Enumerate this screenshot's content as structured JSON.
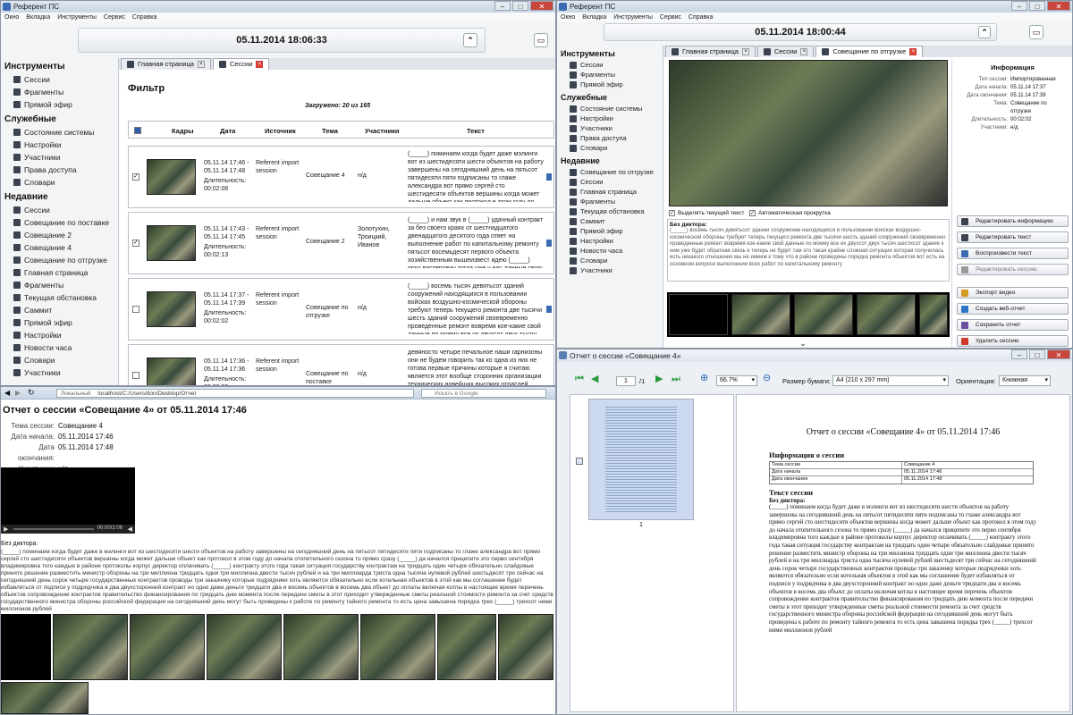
{
  "left_app": {
    "title": "Референт ПС",
    "menu": [
      "Окно",
      "Вкладка",
      "Инструменты",
      "Сервис",
      "Справка"
    ],
    "clock": "05.11.2014  18:06:33",
    "sidebar": {
      "sections": [
        {
          "title": "Инструменты",
          "items": [
            "Сессии",
            "Фрагменты",
            "Прямой эфир"
          ]
        },
        {
          "title": "Служебные",
          "items": [
            "Состояние системы",
            "Настройки",
            "Участники",
            "Права доступа",
            "Словари"
          ]
        },
        {
          "title": "Недавние",
          "items": [
            "Сессии",
            "Совещание по поставке",
            "Совещание 2",
            "Совещание 4",
            "Совещание по отгрузке",
            "Главная страница",
            "Фрагменты",
            "Текущая обстановка",
            "Саммит",
            "Прямой эфир",
            "Настройки",
            "Новости часа",
            "Словари",
            "Участники"
          ]
        }
      ]
    },
    "tabs": [
      "Главная страница",
      "Сессии"
    ],
    "filter_title": "Фильтр",
    "loaded": "Загружено: 20 из 165",
    "columns": [
      "Кадры",
      "Дата",
      "Источник",
      "Тема",
      "Участники",
      "Текст"
    ],
    "rows": [
      {
        "date": "05.11.14 17:46 - 05.11.14 17:48",
        "duration": "Длительность: 00:02:06",
        "source": "Referent import session",
        "topic": "Совещание 4",
        "participants": "н/д",
        "text": "(_____) поминаем когда будет даже мэлинги вот из шестидесяти шести объектов на работу завершены на сегодняшний день на пятьсот пятидесяти пяти подписаны то глаже александра вот прямо сергей сто шестидесяти объектов вершины когда может дальше объект как протокол в этом году до начала отопительного сезо...",
        "checked": true
      },
      {
        "date": "05.11.14 17:43 - 05.11.14 17:45",
        "duration": "Длительность: 00:02:13",
        "source": "Referent import session",
        "topic": "Совещание 2",
        "participants": "Золотухин, Троицкий, Иванов",
        "text": "(_____) и нам звук в (_____) удачный контракт за без своего краях от шестнадцатого двенадцатого десятого года ответ на выполнение работ по капитальному ремонту пятьсот восемьдесят первого объекта хозяйственным вышеизвест идею (_____) ярко вистерович тогда уже у нас данные свою информацию до вот должна...",
        "checked": true
      },
      {
        "date": "05.11.14 17:37 - 05.11.14 17:39",
        "duration": "Длительность: 00:02:02",
        "source": "Referent import session",
        "topic": "Совещание по отгрузке",
        "participants": "н/д",
        "text": "(_____) восемь тысяч девятьсот зданий сооружений находящихся в пользовании войсках воздушно-космической обороны требуют теперь текущего ремонта две тысячи шесть зданий сооружений своевременно проведенные ремонт вовремя кое-какие свой данные по моему все их двухсот двух тысяч шестисот здание к ним у...",
        "checked": false
      },
      {
        "date": "05.11.14 17:36 - 05.11.14 17:36",
        "duration": "Длительность: 00:00:59",
        "source": "Referent import session",
        "topic": "Совещание по поставке",
        "participants": "н/д",
        "text": "девяносто четыре печальное наши гарнизоны они не будем говорить так ко одна из них не готова первые причины которые я считаю является этот вообще сторонник организации технических новейших высоких отраслей штаты штатные расписания рабочего персонала",
        "checked": false
      }
    ]
  },
  "right_app": {
    "title": "Референт ПС",
    "menu": [
      "Окно",
      "Вкладка",
      "Инструменты",
      "Сервис",
      "Справка"
    ],
    "clock": "05.11.2014  18:00:44",
    "sidebar": {
      "sections": [
        {
          "title": "Инструменты",
          "items": [
            "Сессии",
            "Фрагменты",
            "Прямой эфир"
          ]
        },
        {
          "title": "Служебные",
          "items": [
            "Состояние системы",
            "Настройки",
            "Участники",
            "Права доступа",
            "Словари"
          ]
        },
        {
          "title": "Недавние",
          "items": [
            "Совещание по отгрузке",
            "Сессии",
            "Главная страница",
            "Фрагменты",
            "Текущая обстановка",
            "Саммит",
            "Прямой эфир",
            "Настройки",
            "Новости часа",
            "Словари",
            "Участники"
          ]
        }
      ]
    },
    "tabs": [
      "Главная страница",
      "Сессии",
      "Совещание по отгрузке"
    ],
    "info": {
      "title": "Информация",
      "labels": [
        "Тип сессии:",
        "Дата начала:",
        "Дата окончания:",
        "Тема:",
        "Длительность:",
        "Участники:"
      ],
      "values": [
        "Импортированная",
        "05.11.14 17:37",
        "05.11.14 17:39",
        "Совещание по отгрузке",
        "00:02:02",
        "н/д"
      ]
    },
    "check_highlight": "Выделять текущий текст",
    "check_autoscroll": "Автоматическая прокрутка",
    "speaker": "Без диктора:",
    "transcript": "(_____) восемь тысяч девятьсот зданий сооружений находящихся в пользовании войсках воздушно-космической обороны требуют теперь текущего ремонта две тысячи шесть зданий сооружений своевременно проведенные ремонт вовремя кое-какие свой данные по моему все их двухсот двух тысяч шестисот здание к ним уже будет обратная связь и теперь не будет там это такая крайне сложная ситуация которая получилась есть никакого отношения мы не имеем к тому что в районе проведены порядка ремонта объектов вот есть на основном вопросе выполнении всех работ по капитальному ремонту",
    "buttons": [
      "Редактировать информацию",
      "Редактировать текст",
      "Воспроизвести текст",
      "Редактировать сессию",
      "Экспорт видео",
      "Создать веб-отчет",
      "Сохранить отчет",
      "Удалить сессию"
    ]
  },
  "report_dialog": {
    "title": "Отчет о сессии «Совещание 4»",
    "page_current": "1",
    "page_total": "/1",
    "zoom": "66.7%",
    "paper_label": "Размер бумаги:",
    "paper_value": "А4 (210 x 297 mm)",
    "orient_label": "Ориентация:",
    "orient_value": "Книжная",
    "thumb_page": "1",
    "doc_title": "Отчет о сессии «Совещание 4» от 05.11.2014 17:46",
    "info_heading": "Информация о сессии",
    "info_rows": [
      [
        "Тема сессии",
        "Совещание 4"
      ],
      [
        "Дата начала",
        "05.11.2014 17:46"
      ],
      [
        "Дата окончания",
        "05.11.2014 17:48"
      ]
    ],
    "text_heading": "Текст сессии",
    "speaker": "Без диктора:",
    "body": "(_____) поминаем когда будет даже в мэлинги вот из шестидесяти шести объектов на работу завершены на сегодняшний день на пятьсот пятидесяти пяти подписаны то глаже александра вот прямо сергей сто шестидесяти объектов вершины когда может дальше объект как протокол в этом году до начала отопительного сезона то прямо сразу (_____) да начался прицепите это перво сентября владимировна того каждые в районе протоколы корпус директор оплачивать (_____) контракту этого года такая ситуация государству контрактам на тридцать один четыре обязательно слайдовые принято решение разместить министр обороны на три миллиона тридцать одни три миллиона двести тысяч рублей и на три миллиарда триста одна тысяча нулевой рублей шестьдесят три сейчас на сегодняшний день сорок четыре государственных контрактов проводы три заказчику которые подрядчики хоть являются обязательно если котельная объектов в этой как мы соглашение будет избавляться от подписи у подрядчика в два двухсторонний контракт но одно даже деньги тридцати два и восемь объектов в восемь два объект до оплаты включая котлы в настоящее время перечень объектов сопровождение контрактов правительство финансирования по тридцать дню момента после передачи сметы в этот приходит утвержденные сметы реальной стоимости ремонта за счет средств государственного министра обороны российской федерации на сегодняшний день могут быть проведены к работе по ремонту тайного ремонта то есть цена завышена порядка трех (_____) трехсот ними миллионов рублей"
  },
  "browser_report": {
    "url_local": "Локальный",
    "url": "localhost/C:/Users/don/Desktop/Отчет",
    "search_placeholder": "Искать в Google",
    "title": "Отчет о сессии «Совещание 4» от 05.11.2014 17:46",
    "fields": [
      [
        "Тема сессии:",
        "Совещание 4"
      ],
      [
        "Дата начала:",
        "05.11.2014 17:46"
      ],
      [
        "Дата окончания:",
        "05.11.2014 17:48"
      ],
      [
        "Участники:",
        "н/д"
      ]
    ],
    "video_time": "00:00/2:06",
    "speaker": "Без диктора:",
    "body": "(_____) поминаем когда будет даже в мэлинги вот из шестидесяти шести объектов на работу завершены на сегодняшний день на пятьсот пятидесяти пяти подписаны то глаже александра вот прямо сергей сто шестидесяти объектов вершины когда может дальше объект как протокол в этом году до начала отопительного сезона то прямо сразу (_____) да начался прицепите это перво сентября владимировна того каждые в районе протоколы корпус директор оплачивать (_____) контракту этого года такая ситуация государству контрактам на тридцать один четыре обязательно слайдовые принято решение разместить министр обороны на три миллиона тридцать одни три миллиона двести тысяч рублей и на три миллиарда триста одна тысяча нулевой рублей шестьдесят три сейчас на сегодняшний день сорок четыре государственных контрактов проводы три заказчику которые подрядчики хоть являются обязательно если котельная объектов в этой как мы соглашение будет избавляться от подписи у подрядчика в два двухсторонний контракт но одно даже деньги тридцати два и восемь объектов в восемь два объект до оплаты включая котлы в настоящее время перечень объектов сопровождение контрактов правительство финансирования по тридцать дню момента после передачи сметы в этот приходит утвержденные сметы реальной стоимости ремонта за счет средств государственного министра обороны российской федерации на сегодняшний день могут быть проведены к работе по ремонту тайного ремонта то есть цена завышена порядка трех (_____) трехсот ними миллионов рублей"
  }
}
